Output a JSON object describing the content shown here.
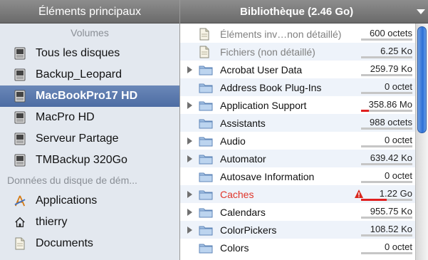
{
  "sidebar": {
    "title": "Éléments principaux",
    "volumes_label": "Volumes",
    "volumes": [
      {
        "label": "Tous les disques",
        "icon": "disk-icon",
        "selected": false
      },
      {
        "label": "Backup_Leopard",
        "icon": "disk-icon",
        "selected": false
      },
      {
        "label": "MacBookPro17 HD",
        "icon": "disk-icon",
        "selected": true
      },
      {
        "label": "MacPro HD",
        "icon": "disk-icon",
        "selected": false
      },
      {
        "label": "Serveur Partage",
        "icon": "disk-icon",
        "selected": false
      },
      {
        "label": "TMBackup 320Go",
        "icon": "disk-icon",
        "selected": false
      }
    ],
    "data_label": "Données du disque de dém...",
    "places": [
      {
        "label": "Applications",
        "icon": "applications-icon"
      },
      {
        "label": "thierry",
        "icon": "home-icon"
      },
      {
        "label": "Documents",
        "icon": "document-icon"
      }
    ]
  },
  "main": {
    "title": "Bibliothèque (2.46 Go)",
    "rows": [
      {
        "name": "Éléments inv…non détaillé)",
        "size": "600 octets",
        "icon": "document-icon",
        "expandable": false,
        "style": "muted",
        "usage": 0
      },
      {
        "name": "Fichiers (non détaillé)",
        "size": "6.25 Ko",
        "icon": "document-icon",
        "expandable": false,
        "style": "muted",
        "usage": 0
      },
      {
        "name": "Acrobat User Data",
        "size": "259.79 Ko",
        "icon": "folder-icon",
        "expandable": true,
        "style": "normal",
        "usage": 0
      },
      {
        "name": "Address Book Plug-Ins",
        "size": "0 octet",
        "icon": "folder-icon",
        "expandable": false,
        "style": "normal",
        "usage": 0
      },
      {
        "name": "Application Support",
        "size": "358.86 Mo",
        "icon": "folder-icon",
        "expandable": true,
        "style": "normal",
        "usage": 0.15
      },
      {
        "name": "Assistants",
        "size": "988 octets",
        "icon": "folder-icon",
        "expandable": false,
        "style": "normal",
        "usage": 0
      },
      {
        "name": "Audio",
        "size": "0 octet",
        "icon": "folder-icon",
        "expandable": true,
        "style": "normal",
        "usage": 0
      },
      {
        "name": "Automator",
        "size": "639.42 Ko",
        "icon": "folder-icon",
        "expandable": true,
        "style": "normal",
        "usage": 0
      },
      {
        "name": "Autosave Information",
        "size": "0 octet",
        "icon": "folder-icon",
        "expandable": false,
        "style": "normal",
        "usage": 0
      },
      {
        "name": "Caches",
        "size": "1.22 Go",
        "icon": "folder-icon",
        "expandable": true,
        "style": "warning",
        "usage": 0.5
      },
      {
        "name": "Calendars",
        "size": "955.75 Ko",
        "icon": "folder-icon",
        "expandable": true,
        "style": "normal",
        "usage": 0
      },
      {
        "name": "ColorPickers",
        "size": "108.52 Ko",
        "icon": "folder-icon",
        "expandable": true,
        "style": "normal",
        "usage": 0
      },
      {
        "name": "Colors",
        "size": "0 octet",
        "icon": "folder-icon",
        "expandable": false,
        "style": "normal",
        "usage": 0
      }
    ]
  },
  "colors": {
    "usage_bar": "#e02020",
    "warning_text": "#e0352a",
    "selection": "#5474aa"
  }
}
